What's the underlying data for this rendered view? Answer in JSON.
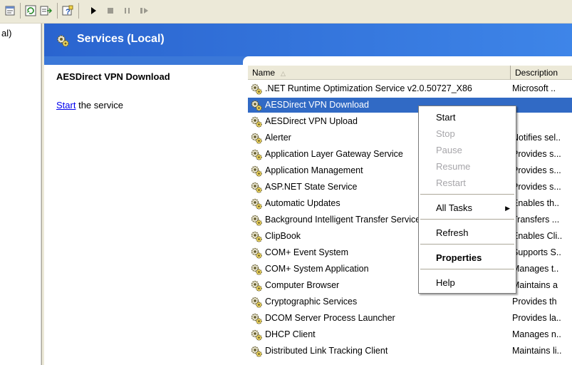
{
  "tree": {
    "label": "al)"
  },
  "header": {
    "title": "Services (Local)"
  },
  "description_pane": {
    "title": "AESDirect VPN Download",
    "link_text": "Start",
    "link_suffix": " the service"
  },
  "columns": {
    "name": "Name",
    "description": "Description"
  },
  "services": [
    {
      "name": ".NET Runtime Optimization Service v2.0.50727_X86",
      "description": "Microsoft ..",
      "selected": false
    },
    {
      "name": "AESDirect VPN Download",
      "description": "",
      "selected": true
    },
    {
      "name": "AESDirect VPN Upload",
      "description": "",
      "selected": false
    },
    {
      "name": "Alerter",
      "description": "Notifies sel..",
      "selected": false
    },
    {
      "name": "Application Layer Gateway Service",
      "description": "Provides s...",
      "selected": false
    },
    {
      "name": "Application Management",
      "description": "Provides s...",
      "selected": false
    },
    {
      "name": "ASP.NET State Service",
      "description": "Provides s...",
      "selected": false
    },
    {
      "name": "Automatic Updates",
      "description": "Enables th..",
      "selected": false
    },
    {
      "name": "Background Intelligent Transfer Service",
      "description": "Transfers ...",
      "selected": false
    },
    {
      "name": "ClipBook",
      "description": "Enables Cli..",
      "selected": false
    },
    {
      "name": "COM+ Event System",
      "description": "Supports S..",
      "selected": false
    },
    {
      "name": "COM+ System Application",
      "description": "Manages t..",
      "selected": false
    },
    {
      "name": "Computer Browser",
      "description": "Maintains a",
      "selected": false
    },
    {
      "name": "Cryptographic Services",
      "description": "Provides th",
      "selected": false
    },
    {
      "name": "DCOM Server Process Launcher",
      "description": "Provides la..",
      "selected": false
    },
    {
      "name": "DHCP Client",
      "description": "Manages n..",
      "selected": false
    },
    {
      "name": "Distributed Link Tracking Client",
      "description": "Maintains li..",
      "selected": false
    }
  ],
  "context_menu": {
    "start": "Start",
    "stop": "Stop",
    "pause": "Pause",
    "resume": "Resume",
    "restart": "Restart",
    "all_tasks": "All Tasks",
    "refresh": "Refresh",
    "properties": "Properties",
    "help": "Help"
  },
  "colors": {
    "header_blue": "#2c6fd6",
    "selection_blue": "#316ac5",
    "toolbar_bg": "#ece9d8",
    "disabled_text": "#a7a6aa"
  },
  "icons": {
    "service": "gear-service-icon",
    "toolbar": [
      "properties-icon",
      "refresh-icon",
      "export-list-icon",
      "help-icon",
      "play-icon",
      "stop-icon",
      "pause-icon",
      "restart-icon"
    ]
  }
}
